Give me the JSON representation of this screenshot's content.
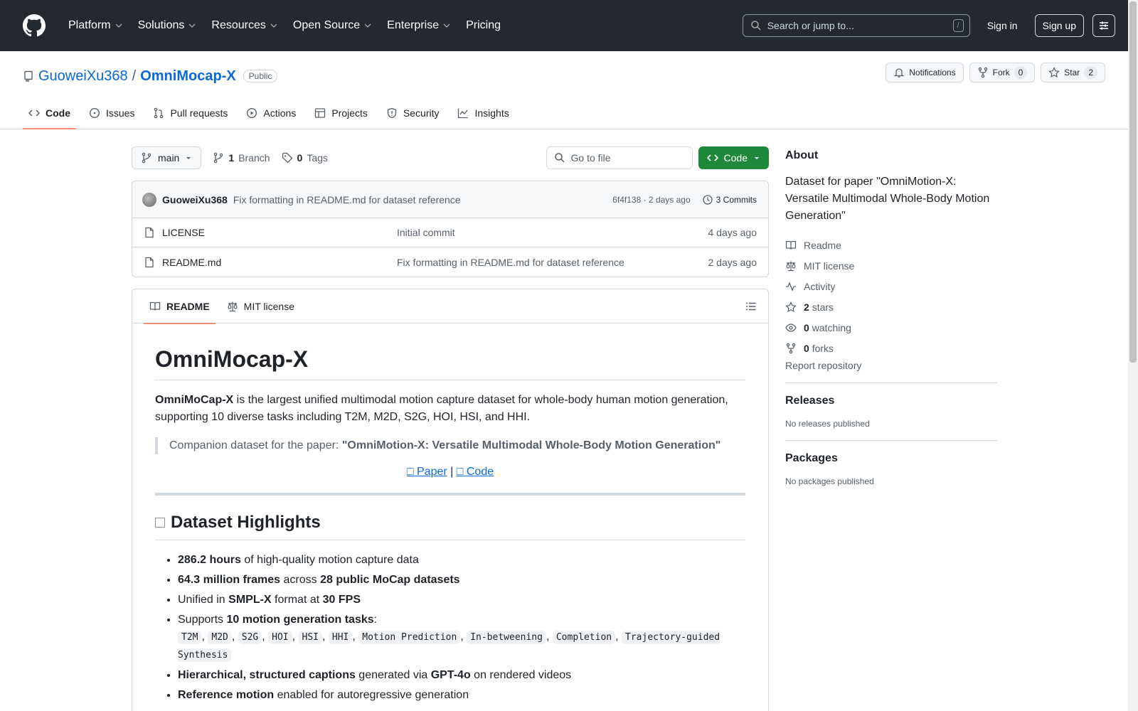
{
  "header": {
    "nav": [
      "Platform",
      "Solutions",
      "Resources",
      "Open Source",
      "Enterprise",
      "Pricing"
    ],
    "search_placeholder": "Search or jump to...",
    "search_shortcut": "/",
    "signin": "Sign in",
    "signup": "Sign up"
  },
  "repo": {
    "owner": "GuoweiXu368",
    "sep": "/",
    "name": "OmniMocap-X",
    "visibility": "Public",
    "notifications": "Notifications",
    "fork_label": "Fork",
    "fork_count": "0",
    "star_label": "Star",
    "star_count": "2",
    "tabs": [
      "Code",
      "Issues",
      "Pull requests",
      "Actions",
      "Projects",
      "Security",
      "Insights"
    ]
  },
  "toolbar": {
    "branch": "main",
    "branch_count": "1",
    "branch_label": "Branch",
    "tag_count": "0",
    "tag_label": "Tags",
    "goto_placeholder": "Go to file",
    "code_button": "Code"
  },
  "commit": {
    "author": "GuoweiXu368",
    "message": "Fix formatting in README.md for dataset reference",
    "hash_time": "6f4f138 · 2 days ago",
    "commits": "3 Commits"
  },
  "files": [
    {
      "name": "LICENSE",
      "message": "Initial commit",
      "date": "4 days ago"
    },
    {
      "name": "README.md",
      "message": "Fix formatting in README.md for dataset reference",
      "date": "2 days ago"
    }
  ],
  "readme": {
    "tab_readme": "README",
    "tab_license": "MIT license",
    "title": "OmniMocap-X",
    "intro_bold": "OmniMoCap-X",
    "intro_rest": " is the largest unified multimodal motion capture dataset for whole-body human motion generation, supporting 10 diverse tasks including T2M, M2D, S2G, HOI, HSI, and HHI.",
    "quote_prefix": "Companion dataset for the paper: ",
    "quote_bold": "\"OmniMotion-X: Versatile Multimodal Whole-Body Motion Generation\"",
    "link_paper": "□ Paper",
    "link_sep": " | ",
    "link_code": "□ Code",
    "highlights_title": "Dataset Highlights",
    "h1_b": "286.2 hours",
    "h1_r": " of high-quality motion capture data",
    "h2_b1": "64.3 million frames",
    "h2_m": " across ",
    "h2_b2": "28 public MoCap datasets",
    "h3_p": "Unified in ",
    "h3_b1": "SMPL-X",
    "h3_m": " format at ",
    "h3_b2": "30 FPS",
    "h4_p": "Supports ",
    "h4_b": "10 motion generation tasks",
    "h4_s": ":",
    "tasks": [
      "T2M",
      "M2D",
      "S2G",
      "HOI",
      "HSI",
      "HHI",
      "Motion Prediction",
      "In-betweening",
      "Completion",
      "Trajectory-guided Synthesis"
    ],
    "h5_b1": "Hierarchical, structured captions",
    "h5_m": " generated via ",
    "h5_b2": "GPT-4o",
    "h5_r": " on rendered videos",
    "h6_b": "Reference motion",
    "h6_r": " enabled for autoregressive generation"
  },
  "sidebar": {
    "about_title": "About",
    "about_desc": "Dataset for paper \"OmniMotion-X: Versatile Multimodal Whole-Body Motion Generation\"",
    "readme": "Readme",
    "license": "MIT license",
    "activity": "Activity",
    "stars_n": "2",
    "stars": "stars",
    "watching_n": "0",
    "watching": "watching",
    "forks_n": "0",
    "forks": "forks",
    "report": "Report repository",
    "releases_title": "Releases",
    "releases_none": "No releases published",
    "packages_title": "Packages",
    "packages_none": "No packages published"
  }
}
